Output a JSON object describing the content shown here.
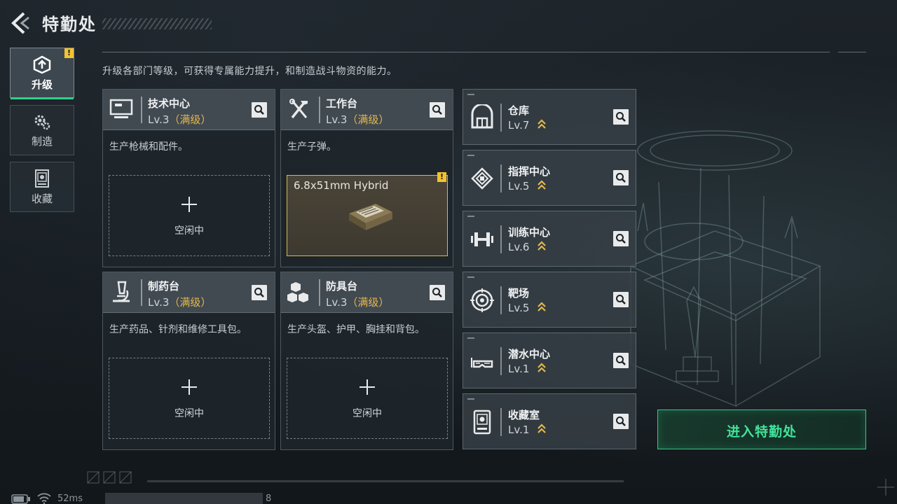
{
  "header": {
    "title": "特勤处"
  },
  "tabs": [
    {
      "label": "升级",
      "icon": "upgrade-gear-icon",
      "active": true,
      "alert": "!"
    },
    {
      "label": "制造",
      "icon": "gears-icon",
      "active": false
    },
    {
      "label": "收藏",
      "icon": "collection-icon",
      "active": false
    }
  ],
  "description": "升级各部门等级，可获得专属能力提升，和制造战斗物资的能力。",
  "departments": [
    {
      "name": "技术中心",
      "level": "Lv.3",
      "max_label": "（满级）",
      "desc": "生产枪械和配件。",
      "slot_plus": "+",
      "slot_text": "空闲中"
    },
    {
      "name": "工作台",
      "level": "Lv.3",
      "max_label": "（满级）",
      "desc": "生产子弹。",
      "craft_item": "6.8x51mm Hybrid",
      "alert": "!"
    },
    {
      "name": "制药台",
      "level": "Lv.3",
      "max_label": "（满级）",
      "desc": "生产药品、针剂和维修工具包。",
      "slot_plus": "+",
      "slot_text": "空闲中"
    },
    {
      "name": "防具台",
      "level": "Lv.3",
      "max_label": "（满级）",
      "desc": "生产头盔、护甲、胸挂和背包。",
      "slot_plus": "+",
      "slot_text": "空闲中"
    }
  ],
  "facilities": [
    {
      "name": "仓库",
      "level": "Lv.7"
    },
    {
      "name": "指挥中心",
      "level": "Lv.5"
    },
    {
      "name": "训练中心",
      "level": "Lv.6"
    },
    {
      "name": "靶场",
      "level": "Lv.5"
    },
    {
      "name": "潜水中心",
      "level": "Lv.1"
    },
    {
      "name": "收藏室",
      "level": "Lv.1"
    }
  ],
  "enter_button": "进入特勤处",
  "footer": {
    "latency": "52ms",
    "number": "8"
  },
  "colors": {
    "accent": "#2fd08a",
    "max_level": "#e2b84c",
    "alert": "#f2c230",
    "craft_border": "#d7b656"
  }
}
